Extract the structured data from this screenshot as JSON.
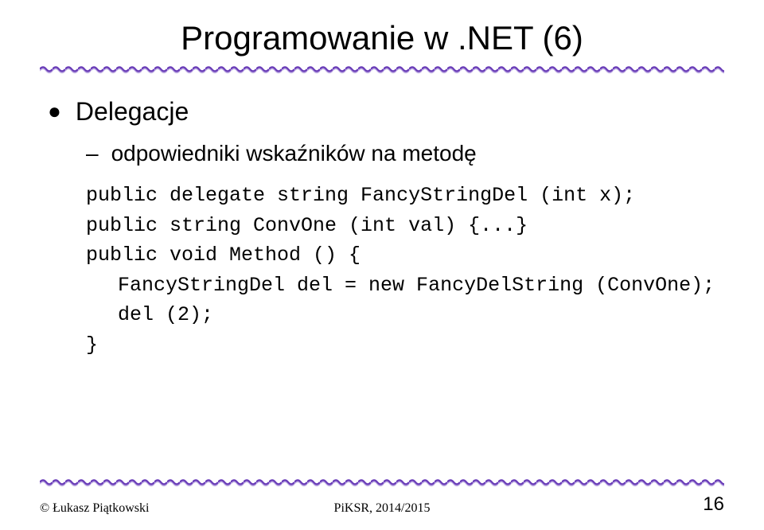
{
  "title": "Programowanie w .NET (6)",
  "bullets": {
    "level1": "Delegacje",
    "level2": "odpowiedniki wskaźników na metodę"
  },
  "code": {
    "line1": "public delegate string FancyStringDel (int x);",
    "line2": "public string ConvOne (int val) {...}",
    "line3": "public void Method () {",
    "line4": "FancyStringDel del = new FancyDelString (ConvOne);",
    "line5": "del (2);",
    "line6": "}"
  },
  "footer": {
    "left": "© Łukasz Piątkowski",
    "center": "PiKSR, 2014/2015",
    "right": "16"
  }
}
